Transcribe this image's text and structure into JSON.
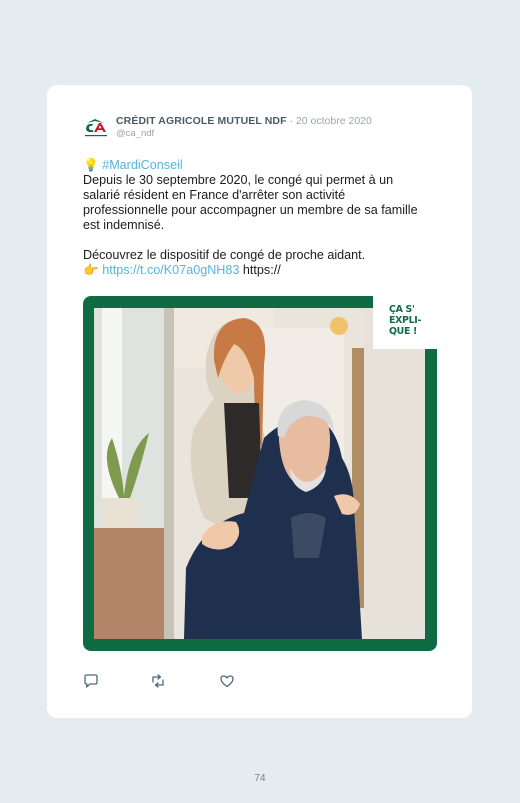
{
  "post": {
    "author_name": "CRÉDIT AGRICOLE MUTUEL NDF",
    "date": " · 20 octobre 2020",
    "handle": "@ca_ndf",
    "hashtag_emoji": "💡",
    "hashtag": "#MardiConseil",
    "body_line": "Depuis le 30 septembre 2020, le congé qui permet à un salarié résident en France d'arrêter son activité professionnelle pour accompagner un membre de sa famille est indemnisé.",
    "cta": "Découvrez le dispositif de congé de proche aidant.",
    "link_emoji": "👉",
    "link": "https://t.co/K07a0gNH83",
    "link_trailing": " https://"
  },
  "media": {
    "badge_text": "ÇA S' EXPLI- QUE !",
    "frame_color": "#0f6b43"
  },
  "actions": {
    "reply_icon": "reply-icon",
    "retweet_icon": "retweet-icon",
    "like_icon": "heart-icon"
  },
  "page": {
    "number": "74"
  },
  "colors": {
    "accent": "#55b4e0",
    "brand_green": "#0f6b43",
    "background": "#e5ecef"
  }
}
